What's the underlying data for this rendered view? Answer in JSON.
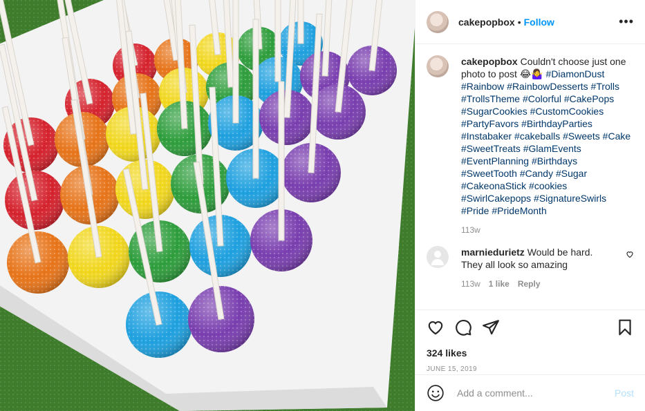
{
  "post": {
    "username": "cakepopbox",
    "separator": "•",
    "follow_label": "Follow",
    "more_label": "•••",
    "photo_description": "Rainbow sparkly cake pops arranged on a white tray",
    "caption": {
      "username": "cakepopbox",
      "text": " Couldn't choose just one photo to post 😂🤷‍♀️ ",
      "hashtags": "#DiamonDust #Rainbow #RainbowDesserts #Trolls #TrollsTheme #Colorful #CakePops #SugarCookies #CustomCookies #PartyFavors #BirthdayParties #Instabaker #cakeballs #Sweets #Cake #SweetTreats #GlamEvents #EventPlanning #Birthdays #SweetTooth #Candy #Sugar #CakeonaStick #cookies #SwirlCakepops #SignatureSwirls #Pride #PrideMonth",
      "age": "113w"
    },
    "comment": {
      "username": "marniedurietz",
      "text": " Would be hard. They all look so amazing",
      "age": "113w",
      "likes": "1 like",
      "reply_label": "Reply"
    },
    "likes_text": "324 likes",
    "date": "JUNE 15, 2019",
    "add_comment_placeholder": "Add a comment...",
    "post_button": "Post",
    "icons": [
      "heart-icon",
      "comment-icon",
      "share-icon",
      "bookmark-icon",
      "emoji-icon"
    ],
    "colors": {
      "accent": "#0095f6",
      "hashtag": "#00376b",
      "muted": "#8e8e8e",
      "post_disabled": "#b2dffc"
    }
  }
}
